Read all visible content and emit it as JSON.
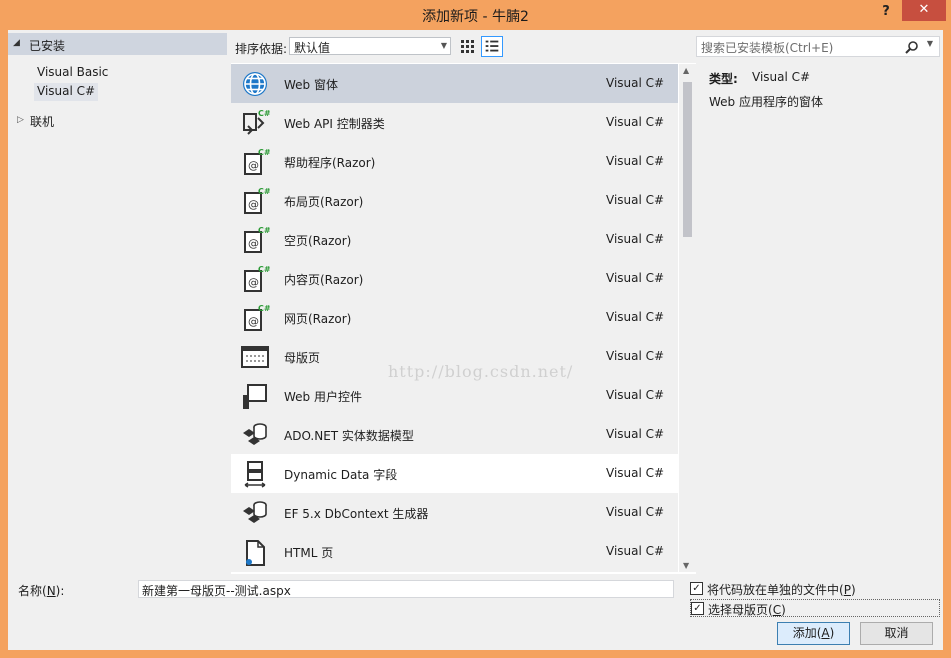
{
  "window": {
    "title": "添加新项 - 牛腩2",
    "help": "?",
    "close": "✕"
  },
  "left": {
    "installed": "已安装",
    "templates": [
      "Visual Basic",
      "Visual C#"
    ],
    "online": "联机"
  },
  "sort": {
    "label": "排序依据:",
    "value": "默认值"
  },
  "items": [
    {
      "name": "Web 窗体",
      "type": "Visual C#",
      "icon": "globe-icon"
    },
    {
      "name": "Web API 控制器类",
      "type": "Visual C#",
      "icon": "api-controller-icon"
    },
    {
      "name": "帮助程序(Razor)",
      "type": "Visual C#",
      "icon": "razor-icon"
    },
    {
      "name": "布局页(Razor)",
      "type": "Visual C#",
      "icon": "razor-icon"
    },
    {
      "name": "空页(Razor)",
      "type": "Visual C#",
      "icon": "razor-icon"
    },
    {
      "name": "内容页(Razor)",
      "type": "Visual C#",
      "icon": "razor-icon"
    },
    {
      "name": "网页(Razor)",
      "type": "Visual C#",
      "icon": "razor-icon"
    },
    {
      "name": "母版页",
      "type": "Visual C#",
      "icon": "master-page-icon"
    },
    {
      "name": "Web 用户控件",
      "type": "Visual C#",
      "icon": "user-control-icon"
    },
    {
      "name": "ADO.NET 实体数据模型",
      "type": "Visual C#",
      "icon": "entity-model-icon"
    },
    {
      "name": "Dynamic Data 字段",
      "type": "Visual C#",
      "icon": "dynamic-data-icon"
    },
    {
      "name": "EF 5.x DbContext 生成器",
      "type": "Visual C#",
      "icon": "entity-model-icon"
    },
    {
      "name": "HTML 页",
      "type": "Visual C#",
      "icon": "html-page-icon"
    }
  ],
  "search": {
    "placeholder": "搜索已安装模板(Ctrl+E)"
  },
  "details": {
    "type_label": "类型:",
    "type_value": "Visual C#",
    "description": "Web 应用程序的窗体"
  },
  "watermark": "http://blog.csdn.net/",
  "footer": {
    "name_label_pre": "名称(",
    "name_label_key": "N",
    "name_label_post": "):",
    "name_value": "新建第一母版页--测试.aspx",
    "separate_file_pre": "将代码放在单独的文件中(",
    "separate_file_key": "P",
    "separate_file_post": ")",
    "separate_file_checked": true,
    "master_pre": "选择母版页(",
    "master_key": "C",
    "master_post": ")",
    "master_checked": true,
    "add_pre": "添加(",
    "add_key": "A",
    "add_post": ")",
    "cancel": "取消"
  }
}
